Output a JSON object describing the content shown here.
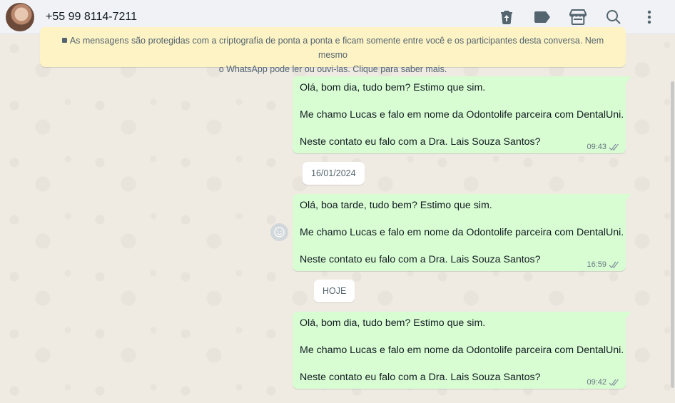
{
  "header": {
    "contact_name": "+55 99 8114-7211",
    "icons": [
      "delete-icon",
      "label-icon",
      "catalog-icon",
      "search-icon",
      "menu-icon"
    ]
  },
  "encryption": {
    "line1": "As mensagens são protegidas com a criptografia de ponta a ponta e ficam somente entre você e os participantes desta conversa. Nem mesmo",
    "line2": "o WhatsApp pode ler ou ouvi-las. Clique para saber mais."
  },
  "messages": [
    {
      "lines": [
        "Olá, bom dia, tudo bem? Estimo que sim.",
        "Me chamo Lucas e falo em nome da Odontolife parceira com DentalUni.",
        "Neste contato eu falo com a Dra. Lais Souza Santos?"
      ],
      "time": "09:43"
    },
    {
      "lines": [
        "Olá, boa tarde, tudo bem? Estimo que sim.",
        "Me chamo Lucas e falo em nome da Odontolife parceira com DentalUni.",
        "Neste contato eu falo com a Dra. Lais Souza Santos?"
      ],
      "time": "16:59"
    },
    {
      "lines": [
        "Olá, bom dia, tudo bem? Estimo que sim.",
        "Me chamo Lucas e falo em nome da Odontolife parceira com DentalUni.",
        "Neste contato eu falo com a Dra. Lais Souza Santos?"
      ],
      "time": "09:42"
    }
  ],
  "date_separators": [
    "16/01/2024",
    "HOJE"
  ],
  "colors": {
    "outgoing_bubble": "#d9fdd3",
    "encryption_banner": "#fdf3c5",
    "chat_background": "#efeae2",
    "header_background": "#f0f2f5"
  }
}
